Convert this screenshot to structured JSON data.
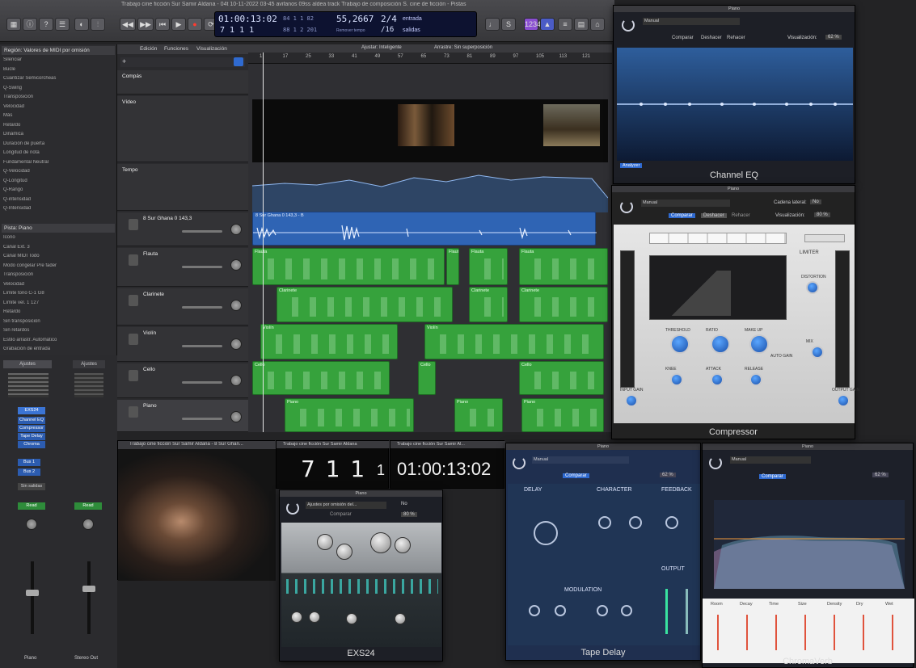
{
  "window": {
    "title": "Trabajo cine ficción Sur Samir Aldana - 04t 10-11-2022 03-45 avifanos 09ss aldea track Trabajo de composición S. cine de ficción - Pistas"
  },
  "transport": {
    "timecode": "01:00:13:02",
    "position": "7  1  1  1",
    "bars_a": "84 1 1 82",
    "bars_b": "88 1 2 201",
    "tempo": "55,2667",
    "tempo_label": "Remover tempo",
    "signature": "2/4",
    "division": "/16",
    "input_label": "entrada",
    "output_label": "salidas"
  },
  "inspector": {
    "region_header": "Región: Valores de MIDI por omisión",
    "track_header": "Pista: Piano",
    "rows": [
      "Silenciar",
      "Bucle",
      "Cuantizar  Semicorcheas",
      "Q-Swing",
      "Transposición",
      "Velocidad",
      "Más",
      "Retardo",
      "Dinámica",
      "Duración de puerta",
      "Longitud de nota",
      "Fundamental Neutral",
      "Q-Velocidad",
      "Q-Longitud",
      "Q-Rango",
      "Q-intensidad",
      "Q-Intensidad"
    ],
    "track_rows": [
      "Icono",
      "Canal  Ext. 3",
      "Canal MIDI  Todo",
      "Modo congelar  Pre fader",
      "Transposición",
      "Velocidad",
      "Límite tono  C-1 G8",
      "Límite vel.  1 127",
      "Retardo",
      "Sin transposición",
      "Sin retardos",
      "Estilo arrastr. Automático",
      "Grabación de entrada"
    ]
  },
  "inspector_buttons": [
    "Ajustes",
    "Ajustes",
    "EXS24",
    "Channel EQ",
    "Compressor",
    "Tape Delay",
    "Chroma",
    "Bus 1",
    "Bus 2",
    "Sin salidas",
    "Read",
    "Read",
    "Piano",
    "Stereo Out"
  ],
  "toolbar": {
    "edit": "Edición",
    "functions": "Funciones",
    "view": "Visualización",
    "snap": "Ajustar: Inteligente",
    "drag": "Arrastre: Sin superposición"
  },
  "ruler": [
    "1",
    "17",
    "25",
    "33",
    "41",
    "49",
    "57",
    "65",
    "73",
    "81",
    "89",
    "97",
    "105",
    "113",
    "121"
  ],
  "tracks": [
    {
      "name": "Compás",
      "kind": "global"
    },
    {
      "name": "Vídeo",
      "kind": "global"
    },
    {
      "name": "Tempo",
      "kind": "global"
    },
    {
      "name": "8 Sur Ghana 0 143,3",
      "kind": "audio"
    },
    {
      "name": "Flauta",
      "kind": "midi"
    },
    {
      "name": "Clarinete",
      "kind": "midi"
    },
    {
      "name": "Violín",
      "kind": "midi"
    },
    {
      "name": "Cello",
      "kind": "midi"
    },
    {
      "name": "Piano",
      "kind": "midi"
    }
  ],
  "regions": {
    "audio_label": "8 Sur Ghana 0 143,3 - B",
    "flauta": [
      "Flauta",
      "Flauta",
      "Flauta",
      "Flauta"
    ],
    "clarinete": [
      "Clarinete",
      "Clarinete",
      "Clarinete"
    ],
    "violin": [
      "Violín",
      "Violín"
    ],
    "cello": [
      "Cello",
      "Cello"
    ],
    "piano": [
      "Piano",
      "Piano",
      "Piano"
    ]
  },
  "video_window": {
    "title": "Trabajo cine ficción Sur Samir Aldana - 8 Sur Ghan..."
  },
  "big_counter": {
    "title": "Trabajo cine ficción Sur Samir Aldana",
    "bars": "7 1 1",
    "sub": "1"
  },
  "big_timecode": {
    "title": "Trabajo cine ficción Sur Samir Al...",
    "value": "01:00:13:02"
  },
  "plugins": {
    "channel_eq": {
      "header": "Piano",
      "name": "Channel EQ",
      "preset": "Manual",
      "compare": "Comparar",
      "copy": "Deshacer",
      "paste": "Rehacer",
      "view": "Visualización:",
      "zoom": "62 %",
      "analyzer": "Analyzer"
    },
    "compressor": {
      "header": "Piano",
      "name": "Compressor",
      "preset": "Manual",
      "compare": "Comparar",
      "undo": "Deshacer",
      "redo": "Rehacer",
      "sidechain_label": "Cadena lateral:",
      "sidechain": "No",
      "view": "Visualización:",
      "zoom": "80 %",
      "knobs": [
        "THRESHOLD",
        "RATIO",
        "MAKE UP",
        "KNEE",
        "ATTACK",
        "RELEASE",
        "LIMITER",
        "DISTORTION",
        "MIX",
        "INPUT GAIN",
        "OUTPUT GAIN"
      ],
      "auto_gain": "AUTO GAIN"
    },
    "exs24": {
      "header": "Piano",
      "name": "EXS24",
      "preset": "Ajustes por omisión del...",
      "zoom": "80 %",
      "compare": "Comparar",
      "sidechain": "No"
    },
    "tape_delay": {
      "header": "Piano",
      "name": "Tape Delay",
      "preset": "Manual",
      "zoom": "62 %",
      "compare": "Comparar",
      "sections": [
        "DELAY",
        "CHARACTER",
        "FEEDBACK",
        "MODULATION",
        "OUTPUT"
      ]
    },
    "chromaverb": {
      "header": "Piano",
      "name": "ChromaVerb",
      "preset": "Manual",
      "zoom": "62 %",
      "compare": "Comparar",
      "params": [
        "Room",
        "Decay",
        "Time",
        "Size",
        "Density",
        "Dry",
        "Wet"
      ]
    }
  },
  "colors": {
    "midi_region": "#36a23c",
    "audio_region": "#2f64b4",
    "accent": "#3a86ff"
  }
}
